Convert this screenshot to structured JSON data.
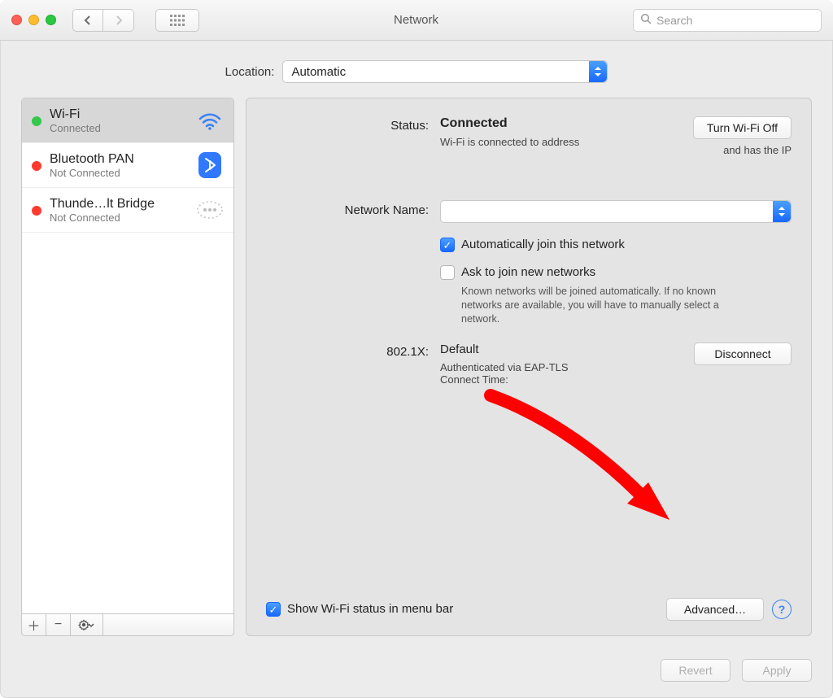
{
  "toolbar": {
    "title": "Network",
    "search_placeholder": "Search"
  },
  "location": {
    "label": "Location:",
    "value": "Automatic"
  },
  "sidebar": {
    "items": [
      {
        "name": "Wi-Fi",
        "status": "Connected",
        "dot": "green",
        "icon": "wifi",
        "selected": true
      },
      {
        "name": "Bluetooth PAN",
        "status": "Not Connected",
        "dot": "red",
        "icon": "bluetooth",
        "selected": false
      },
      {
        "name": "Thunde…lt Bridge",
        "status": "Not Connected",
        "dot": "red",
        "icon": "thunderbolt",
        "selected": false
      }
    ]
  },
  "main": {
    "status_label": "Status:",
    "status_value": "Connected",
    "turn_off_label": "Turn Wi-Fi Off",
    "status_desc": "Wi-Fi is connected to address",
    "ip_note": "and has the IP",
    "network_name_label": "Network Name:",
    "network_name_value": "",
    "auto_join_label": "Automatically join this network",
    "ask_join_label": "Ask to join new networks",
    "ask_join_desc": "Known networks will be joined automatically. If no known networks are available, you will have to manually select a network.",
    "dot1x_label": "802.1X:",
    "dot1x_value": "Default",
    "disconnect_label": "Disconnect",
    "dot1x_auth": "Authenticated via EAP-TLS",
    "dot1x_time_label": "Connect Time:",
    "show_menu_label": "Show Wi-Fi status in menu bar",
    "advanced_label": "Advanced…"
  },
  "footer": {
    "revert": "Revert",
    "apply": "Apply"
  }
}
